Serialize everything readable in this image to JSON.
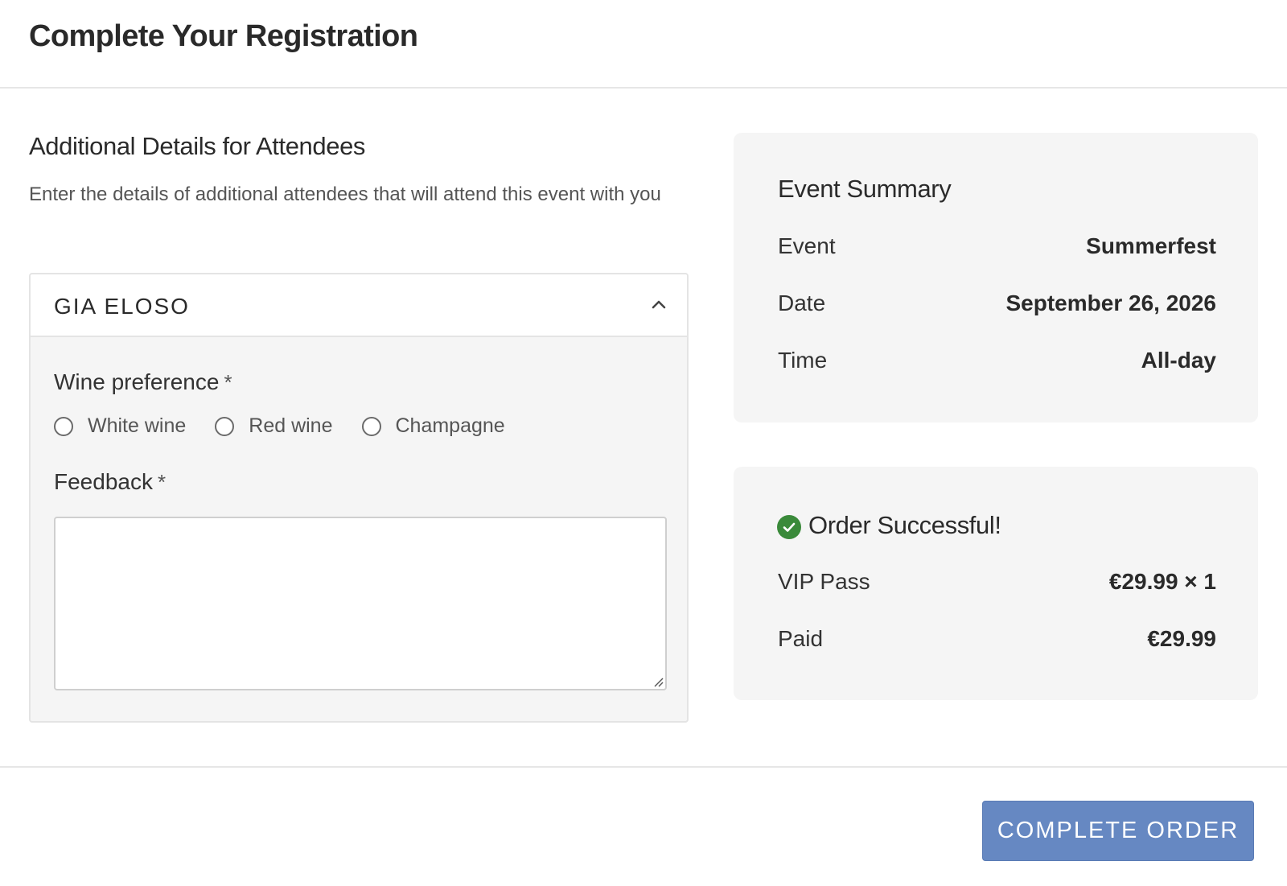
{
  "header": {
    "title": "Complete Your Registration"
  },
  "attendees_section": {
    "title": "Additional Details for Attendees",
    "description": "Enter the details of additional attendees that will attend this event with you",
    "attendee": {
      "name": "GIA ELOSO",
      "expanded": true,
      "wine_preference": {
        "label": "Wine preference",
        "required_mark": "*",
        "options": [
          "White wine",
          "Red wine",
          "Champagne"
        ],
        "selected": null
      },
      "feedback": {
        "label": "Feedback",
        "required_mark": "*",
        "value": ""
      }
    }
  },
  "event_summary": {
    "title": "Event Summary",
    "rows": [
      {
        "key": "Event",
        "value": "Summerfest"
      },
      {
        "key": "Date",
        "value": "September 26, 2026"
      },
      {
        "key": "Time",
        "value": "All-day"
      }
    ]
  },
  "order": {
    "title": "Order Successful!",
    "status_color": "#3a8a3a",
    "rows": [
      {
        "key": "VIP Pass",
        "value": "€29.99 × 1"
      },
      {
        "key": "Paid",
        "value": "€29.99"
      }
    ]
  },
  "footer": {
    "complete_label": "COMPLETE ORDER",
    "button_color": "#6688c2"
  }
}
